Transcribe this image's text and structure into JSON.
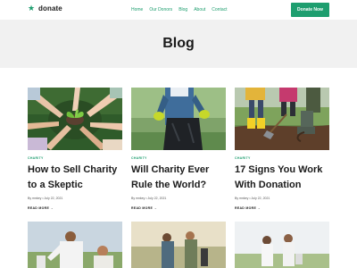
{
  "header": {
    "logo_text": "donate",
    "nav": [
      "Home",
      "Our Donors",
      "Blog",
      "About",
      "Contact"
    ],
    "cta_label": "Donate Now"
  },
  "hero": {
    "title": "Blog"
  },
  "posts": [
    {
      "category": "CHARITY",
      "title_line1": "How to Sell Charity",
      "title_line2": "to a Skeptic",
      "meta": "By mnkey • July 22, 2021",
      "read_more": "READ MORE →"
    },
    {
      "category": "CHARITY",
      "title_line1": "Will Charity Ever",
      "title_line2": "Rule the World?",
      "meta": "By mnkey • July 22, 2021",
      "read_more": "READ MORE →"
    },
    {
      "category": "CHARITY",
      "title_line1": "17 Signs You Work",
      "title_line2": "With Donation",
      "meta": "By mnkey • July 22, 2021",
      "read_more": "READ MORE →"
    }
  ],
  "colors": {
    "accent": "#1e9e6f",
    "hero_bg": "#f1f1f1"
  },
  "icons": {
    "logo": "star-icon",
    "arrow": "arrow-right-icon"
  }
}
